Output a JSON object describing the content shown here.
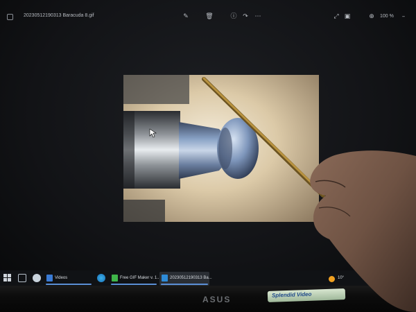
{
  "photos_app": {
    "file_title": "20230512190313 Baracuda 8.gif",
    "zoom_level": "100 %",
    "toolbar": {
      "edit_icon": "edit-image-icon",
      "delete_icon": "trash-icon",
      "info_icon": "info-icon",
      "share_icon": "share-icon",
      "more_icon": "more-icon",
      "expand_icon": "expand-icon",
      "fit_icon": "fit-screen-icon",
      "zoom_icon": "zoom-in-icon",
      "minimize_icon": "minimize-icon"
    }
  },
  "taskbar": {
    "start_icon": "windows-start-icon",
    "items": [
      {
        "label": "Videos",
        "icon": "folder-icon",
        "color": "#3a7bd5"
      },
      {
        "label": "Free GIF Maker v. 1...",
        "icon": "gif-maker-icon",
        "color": "#3fb549"
      },
      {
        "label": "20230512190313 Ba...",
        "icon": "photos-icon",
        "color": "#2e8bd8"
      }
    ],
    "weather": "10°"
  },
  "bezel": {
    "brand": "ASUS",
    "sticker": "Splendid Video"
  },
  "colors": {
    "accent": "#5b8fd6",
    "screen_bg": "#121316",
    "image_bg": "#d9c8ad"
  }
}
